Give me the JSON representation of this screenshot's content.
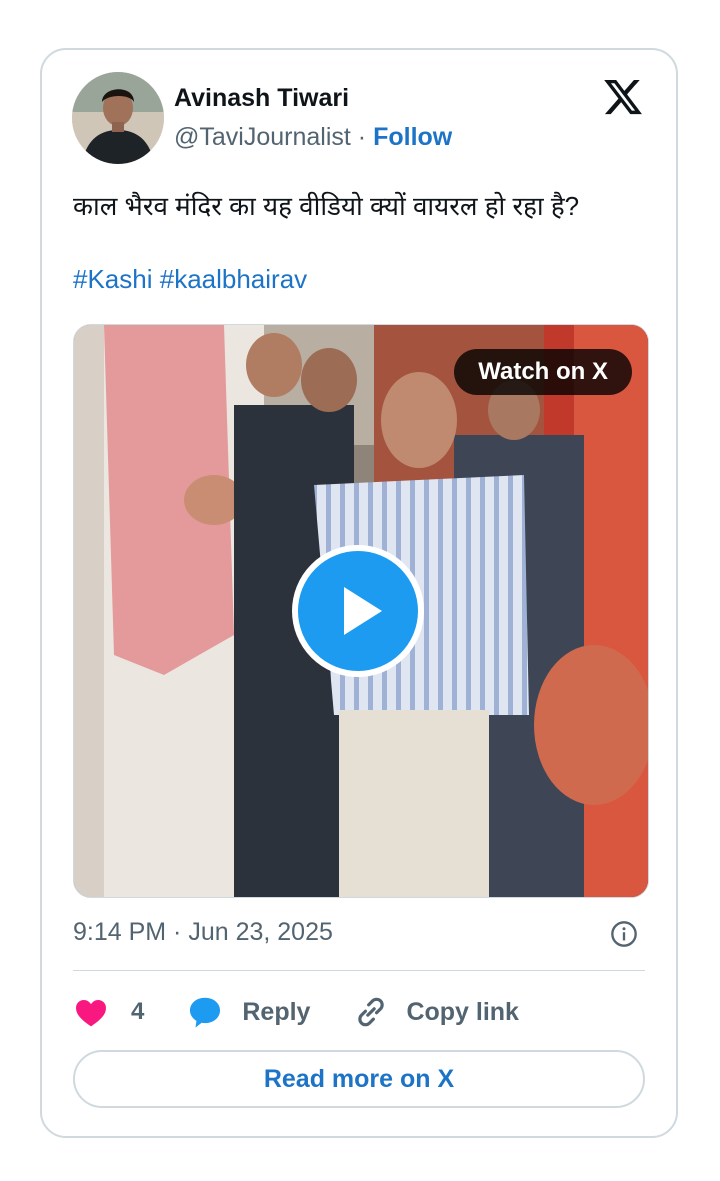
{
  "author": {
    "name": "Avinash Tiwari",
    "handle": "@TaviJournalist",
    "separator": "·",
    "follow_label": "Follow"
  },
  "tweet": {
    "text": "काल भैरव मंदिर का यह वीडियो क्यों वायरल हो रहा है?",
    "hashtags": [
      "#Kashi",
      "#kaalbhairav"
    ]
  },
  "media": {
    "watch_label": "Watch on X"
  },
  "timestamp": "9:14 PM · Jun 23, 2025",
  "actions": {
    "like_count": "4",
    "reply_label": "Reply",
    "copy_link_label": "Copy link"
  },
  "read_more_label": "Read more on X",
  "icons": {
    "logo": "x-logo-icon",
    "like": "heart-icon",
    "reply": "reply-bubble-icon",
    "copy": "link-icon",
    "info": "info-icon",
    "play": "play-icon"
  },
  "colors": {
    "link": "#1d74c7",
    "play_button": "#1d9bf0",
    "heart": "#f91880",
    "muted_text": "#536471",
    "border": "#cfd9de"
  }
}
